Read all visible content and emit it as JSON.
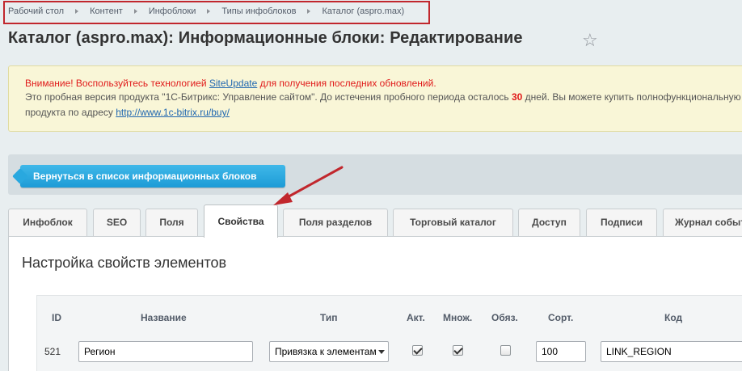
{
  "breadcrumb": [
    "Рабочий стол",
    "Контент",
    "Инфоблоки",
    "Типы инфоблоков",
    "Каталог (aspro.max)"
  ],
  "page_title": "Каталог (aspro.max): Информационные блоки: Редактирование",
  "notice": {
    "warning_prefix": "Внимание! Воспользуйтесь технологией ",
    "warning_link": "SiteUpdate",
    "warning_suffix": " для получения последних обновлений.",
    "trial_prefix": "Это пробная версия продукта \"1С-Битрикс: Управление сайтом\". До истечения пробного периода осталось ",
    "trial_days": "30",
    "trial_suffix": " дней. Вы можете купить полнофункциональную версию",
    "address_prefix": "продукта по адресу ",
    "address_link": "http://www.1c-bitrix.ru/buy/"
  },
  "back_button": "Вернуться в список информационных блоков",
  "tabs": [
    "Инфоблок",
    "SEO",
    "Поля",
    "Свойства",
    "Поля разделов",
    "Торговый каталог",
    "Доступ",
    "Подписи",
    "Журнал событий"
  ],
  "active_tab": "Свойства",
  "section_title": "Настройка свойств элементов",
  "table": {
    "headers": [
      "ID",
      "Название",
      "Тип",
      "Акт.",
      "Множ.",
      "Обяз.",
      "Сорт.",
      "Код"
    ],
    "rows": [
      {
        "id": "521",
        "name": "Регион",
        "type": "Привязка к элементам",
        "active": true,
        "multiple": true,
        "required": false,
        "sort": "100",
        "code": "LINK_REGION"
      }
    ]
  },
  "colors": {
    "accent": "#1d9bd6",
    "annotation": "#c1272d",
    "warning": "#e01a1a"
  }
}
